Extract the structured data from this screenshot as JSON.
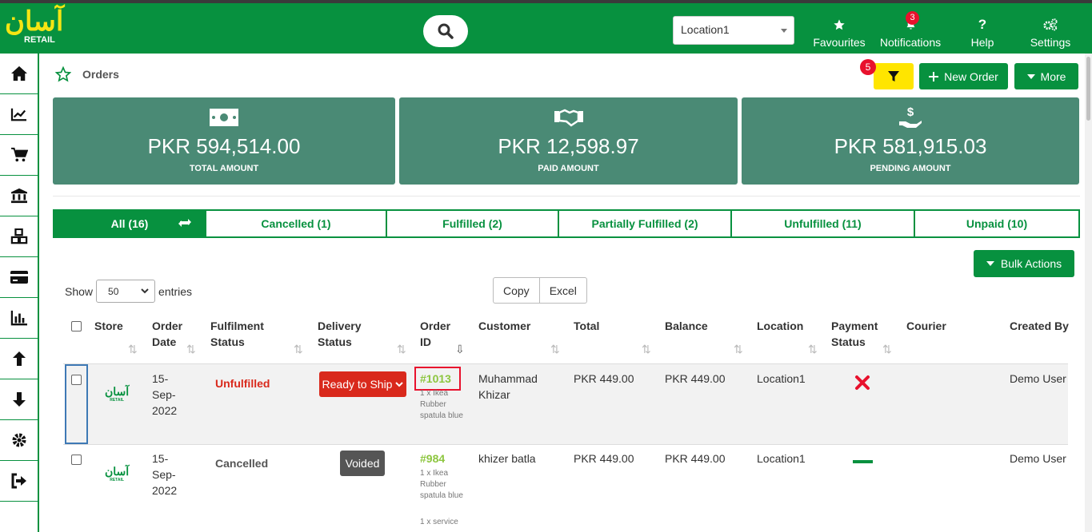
{
  "brand": {
    "logo_ar": "آسان",
    "logo_en": "RETAIL"
  },
  "topbar": {
    "location": "Location1",
    "nav": [
      {
        "label": "Favourites",
        "icon": "star-icon"
      },
      {
        "label": "Notifications",
        "icon": "bell-icon",
        "badge": "3"
      },
      {
        "label": "Help",
        "icon": "question-icon"
      },
      {
        "label": "Settings",
        "icon": "gears-icon"
      }
    ]
  },
  "sidebar": [
    "home-icon",
    "chart-icon",
    "cart-icon",
    "bank-icon",
    "boxes-icon",
    "card-icon",
    "report-icon",
    "arrow-up-icon",
    "arrow-down-icon",
    "gear-icon",
    "logout-icon"
  ],
  "page": {
    "title": "Orders",
    "filter_badge": "5",
    "new_order": "New Order",
    "more": "More"
  },
  "summary": [
    {
      "amount": "PKR 594,514.00",
      "label": "TOTAL AMOUNT"
    },
    {
      "amount": "PKR 12,598.97",
      "label": "PAID AMOUNT"
    },
    {
      "amount": "PKR 581,915.03",
      "label": "PENDING AMOUNT"
    }
  ],
  "tabs": [
    "All (16)",
    "Cancelled (1)",
    "Fulfilled (2)",
    "Partially Fulfilled (2)",
    "Unfulfilled (11)",
    "Unpaid (10)"
  ],
  "table_controls": {
    "bulk": "Bulk Actions",
    "show": "Show",
    "entries_value": "50",
    "entries": "entries",
    "copy": "Copy",
    "excel": "Excel"
  },
  "columns": [
    "Store",
    "Order Date",
    "Fulfilment Status",
    "Delivery Status",
    "Order ID",
    "Customer",
    "Total",
    "Balance",
    "Location",
    "Payment Status",
    "Courier",
    "Created By"
  ],
  "rows": [
    {
      "date": "15-Sep-2022",
      "fulfilment": "Unfulfilled",
      "delivery": "Ready to Ship",
      "order_id": "#1013",
      "items": "1 x Ikea Rubber spatula blue",
      "customer": "Muhammad Khizar",
      "total": "PKR 449.00",
      "balance": "PKR 449.00",
      "location": "Location1",
      "created_by": "Demo User"
    },
    {
      "date": "15-Sep-2022",
      "fulfilment": "Cancelled",
      "delivery": "Voided",
      "order_id": "#984",
      "items": "1 x Ikea Rubber spatula blue",
      "items2": "1 x service",
      "customer": "khizer batla",
      "total": "PKR 449.00",
      "balance": "PKR 449.00",
      "location": "Location1",
      "created_by": "Demo User"
    }
  ]
}
